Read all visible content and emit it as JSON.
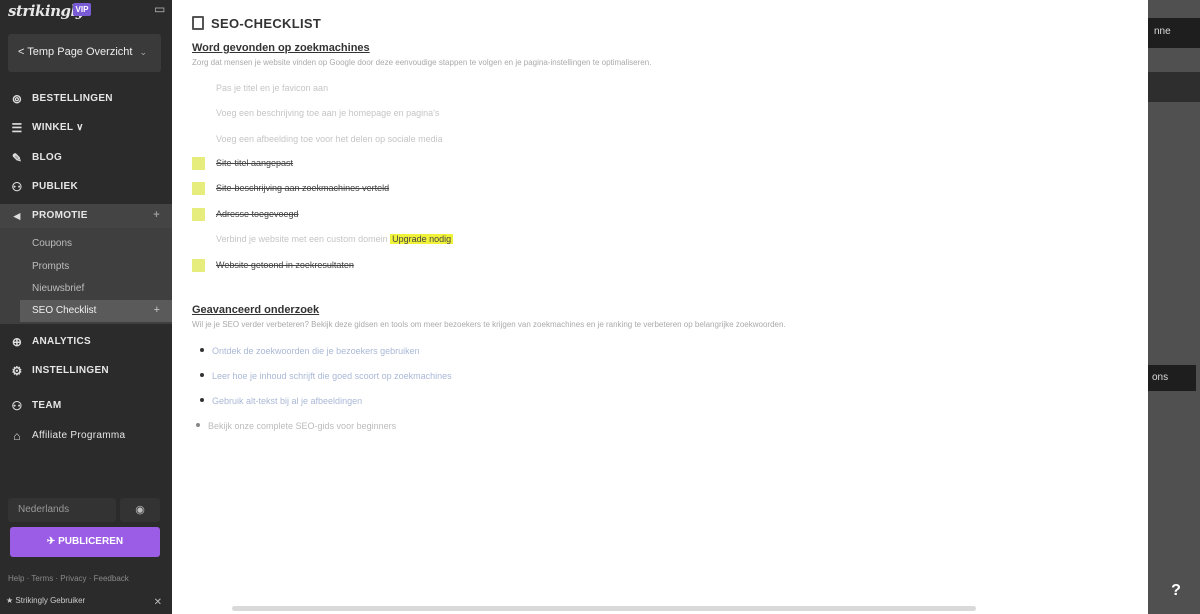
{
  "brand": {
    "logo_text": "strikingly",
    "badge": "VIP"
  },
  "site_selector": {
    "label": "< Temp Page Overzicht"
  },
  "nav": {
    "bestellingen": "BESTELLINGEN",
    "winkel": "WINKEL ∨",
    "blog": "BLOG",
    "publiek": "PUBLIEK",
    "promotie": "PROMOTIE",
    "analytics": "ANALYTICS",
    "instellingen": "INSTELLINGEN",
    "team": "TEAM",
    "affiliate": "Affiliate Programma"
  },
  "promotie_sub": [
    "Coupons",
    "Prompts",
    "Nieuwsbrief"
  ],
  "promotie_active_sub": "SEO Checklist",
  "bottom": {
    "language": "Nederlands",
    "preview_icon": "eye-icon",
    "publish": "PUBLICEREN",
    "footer_links": "Help · Terms · Privacy · Feedback",
    "footer_user": "Strikingly Gebruiker"
  },
  "panel": {
    "title": "SEO-CHECKLIST",
    "section1": {
      "heading": "Word gevonden op zoekmachines",
      "description": "Zorg dat mensen je website vinden op Google door deze eenvoudige stappen te volgen en je pagina-instellingen te optimaliseren.",
      "items": [
        {
          "text": "Pas je titel en je favicon aan",
          "done": false
        },
        {
          "text": "Voeg een beschrijving toe aan je homepage en pagina's",
          "done": false
        },
        {
          "text": "Voeg een afbeelding toe voor het delen op sociale media",
          "done": false
        },
        {
          "text": "Site-titel aangepast",
          "done": true
        },
        {
          "text": "Site-beschrijving aan zoekmachines verteld",
          "done": true
        },
        {
          "text": "Adresse toegevoegd",
          "done": true
        },
        {
          "text": "Verbind je website met een custom domein",
          "done": false,
          "highlight": "Upgrade nodig"
        },
        {
          "text": "Website getoond in zoekresultaten",
          "done": true
        }
      ]
    },
    "section2": {
      "heading": "Geavanceerd onderzoek",
      "description": "Wil je je SEO verder verbeteren? Bekijk deze gidsen en tools om meer bezoekers te krijgen van zoekmachines en je ranking te verbeteren op belangrijke zoekwoorden.",
      "bullets": [
        "Ontdek de zoekwoorden die je bezoekers gebruiken",
        "Leer hoe je inhoud schrijft die goed scoort op zoekmachines",
        "Gebruik alt-tekst bij al je afbeeldingen",
        "Bekijk onze complete SEO-gids voor beginners"
      ]
    }
  },
  "right_strip": {
    "top_label": "nne",
    "mid_label": "ons",
    "help": "?"
  },
  "colors": {
    "accent": "#9b5de5",
    "checkbox": "#e7ed7d",
    "highlight": "#f0f23a",
    "sidebar": "#2b2b2b"
  }
}
